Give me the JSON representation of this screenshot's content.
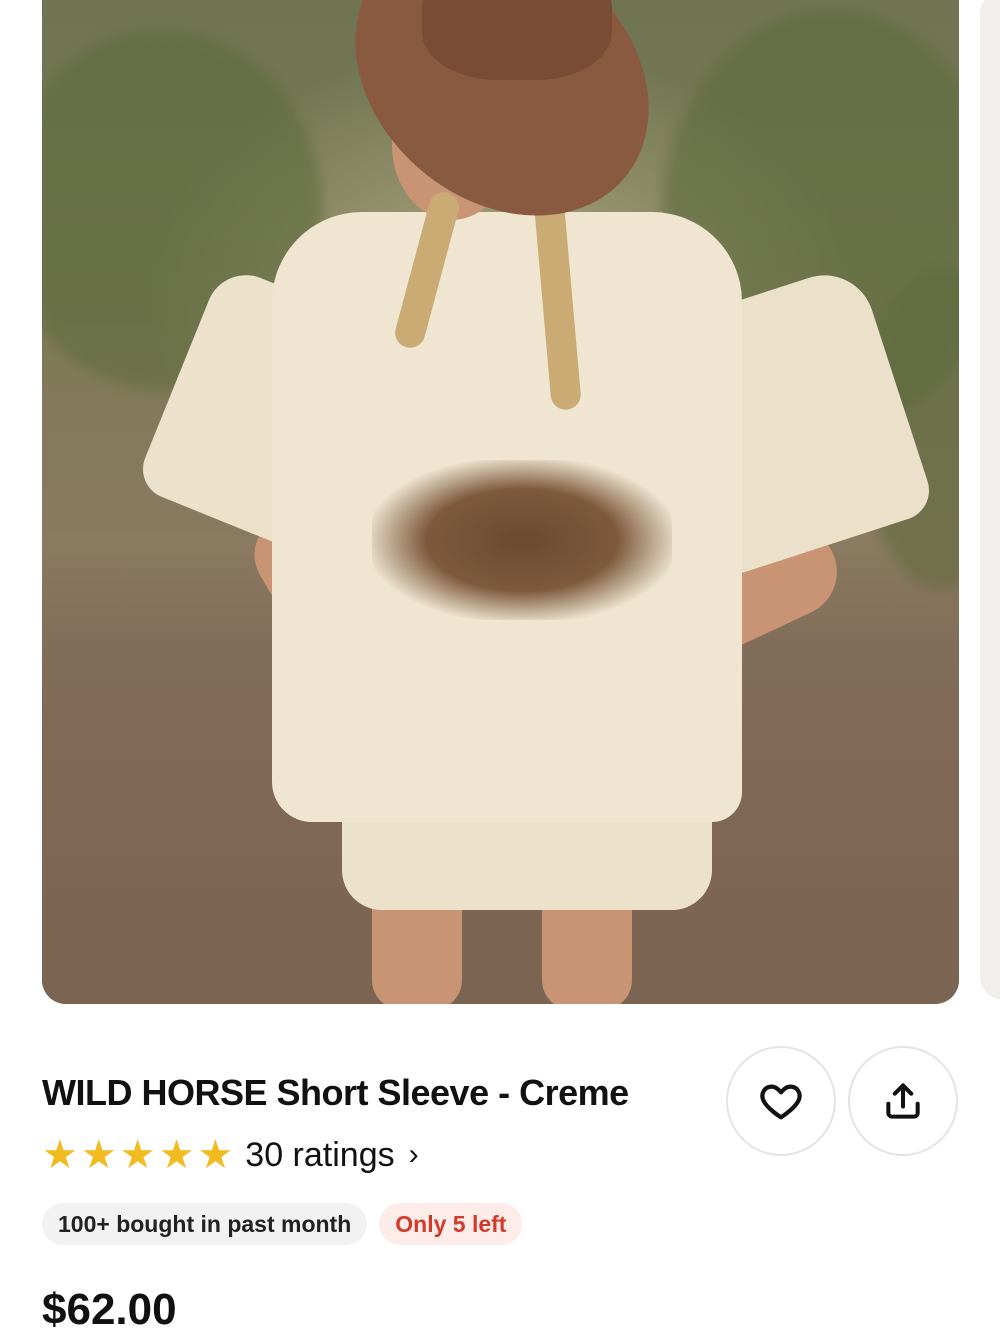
{
  "product": {
    "title": "WILD HORSE Short Sleeve - Creme",
    "rating": {
      "stars": 5,
      "count_label": "30 ratings",
      "chevron": "›"
    },
    "badges": {
      "bought": "100+ bought in past month",
      "stock": "Only 5 left"
    },
    "price": "$62.00",
    "image": {
      "description_icon": "product-photo"
    }
  },
  "actions": {
    "favorite_icon": "heart-outline-icon",
    "share_icon": "share-upload-icon"
  },
  "colors": {
    "star": "#f2bb1f",
    "stock_text": "#d23a2a",
    "stock_bg": "#fdecea",
    "badge_bg": "#f2f2f2"
  }
}
